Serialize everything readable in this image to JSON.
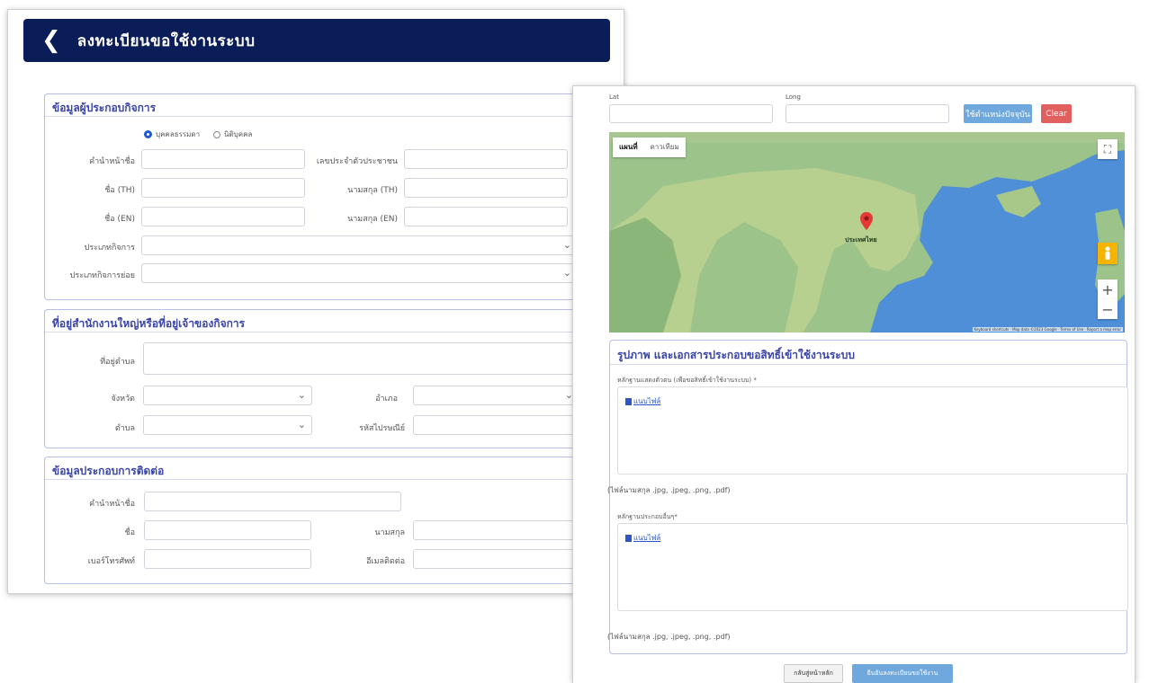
{
  "left_window": {
    "header": {
      "back_icon": "chevron-left-icon",
      "title": "ลงทะเบียนขอใช้งานระบบ"
    },
    "operator_section": {
      "title": "ข้อมูลผู้ประกอบกิจการ",
      "radio_options": [
        "บุคคลธรรมดา",
        "นิติบุคคล"
      ],
      "selected_radio": "บุคคลธรรมดา",
      "fields": {
        "prefix": "คำนำหน้าชื่อ",
        "id_number": "เลขประจำตัวประชาชน",
        "first_name_th": "ชื่อ (TH)",
        "last_name_th": "นามสกุล (TH)",
        "first_name_en": "ชื่อ (EN)",
        "last_name_en": "นามสกุล (EN)",
        "business_type": "ประเภทกิจการ",
        "business_subtype": "ประเภทกิจการย่อย"
      }
    },
    "address_section": {
      "title": "ที่อยู่สำนักงานใหญ่หรือที่อยู่เจ้าของกิจการ",
      "fields": {
        "address": "ที่อยู่ตำบล",
        "province": "จังหวัด",
        "district": "อำเภอ",
        "subdistrict": "ตำบล",
        "postal_code": "รหัสไปรษณีย์"
      }
    },
    "contact_section": {
      "title": "ข้อมูลประกอบการติดต่อ",
      "fields": {
        "prefix": "คำนำหน้าชื่อ",
        "first_name": "ชื่อ",
        "last_name": "นามสกุล",
        "phone": "เบอร์โทรศัพท์",
        "email": "อีเมลติดต่อ"
      }
    }
  },
  "right_window": {
    "coords": {
      "lat_label": "Lat",
      "long_label": "Long"
    },
    "buttons": {
      "locate": "ใช้ตำแหน่งปัจจุบัน",
      "clear": "Clear"
    },
    "map": {
      "tabs": [
        "แผนที่",
        "ดาวเทียม"
      ],
      "active_tab": "แผนที่",
      "country_label": "ประเทศไทย",
      "attribution": "Keyboard shortcuts · Map data ©2023 Google · Terms of Use · Report a map error"
    },
    "docs_section": {
      "title": "รูปภาพ และเอกสารประกอบขอสิทธิ์เข้าใช้งานระบบ",
      "upload1_label": "หลักฐานแสดงตัวตน (เพื่อขอสิทธิ์เข้าใช้งานระบบ) *",
      "upload2_label": "หลักฐานประกอบอื่นๆ*",
      "upload_link": "แนบไฟล์",
      "hint": "(ไฟล์นามสกุล .jpg, .jpeg, .png, .pdf)"
    },
    "footer": {
      "back_button": "กลับสู่หน้าหลัก",
      "submit_button": "ยืนยันลงทะเบียนขอใช้งาน"
    }
  },
  "colors": {
    "header_bg": "#0b1d58",
    "section_title": "#3a45a8",
    "section_border": "#b8bde8",
    "locate_button": "#6fa8dc",
    "clear_button": "#e06060",
    "submit_button": "#6fa8dc"
  }
}
